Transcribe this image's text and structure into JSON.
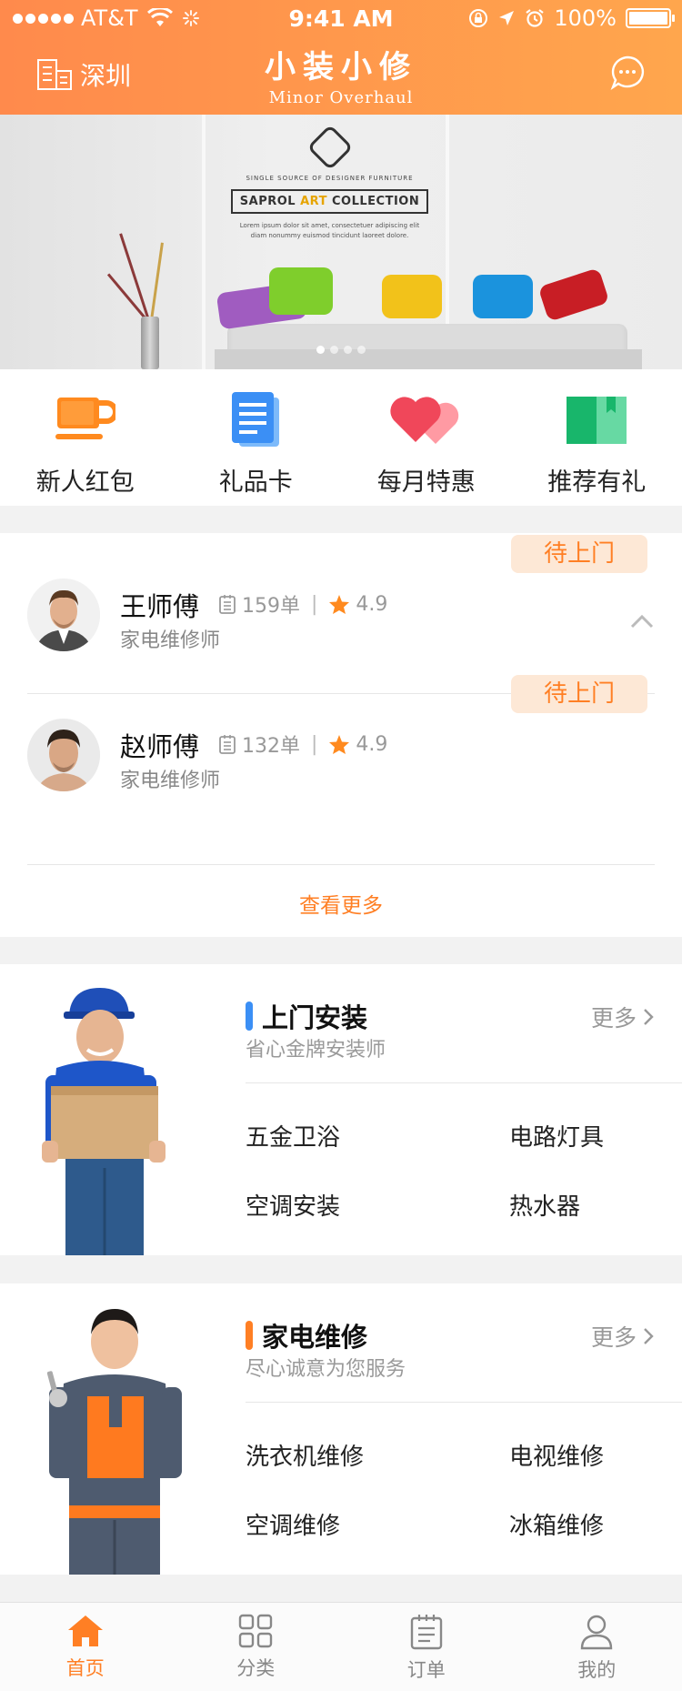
{
  "status_bar": {
    "carrier": "AT&T",
    "time": "9:41 AM",
    "battery": "100%"
  },
  "header": {
    "city": "深圳",
    "logo_cn": "小装小修",
    "logo_en": "Minor Overhaul",
    "chat_icon": "chat-bubble-icon"
  },
  "banner": {
    "brand_tagline": "SINGLE SOURCE OF DESIGNER FURNITURE",
    "brand_prefix": "SAPROL ",
    "brand_art": "ART",
    "brand_suffix": " COLLECTION",
    "brand_lorem": "Lorem ipsum dolor sit amet, consectetuer adipiscing elit diam nonummy euismod tincidunt laoreet dolore.",
    "slide_count": 4,
    "active_slide": 1
  },
  "quick_menu": [
    {
      "label": "新人红包",
      "icon": "cup-icon",
      "color": "#ff8a1f"
    },
    {
      "label": "礼品卡",
      "icon": "document-icon",
      "color": "#3b8ff5"
    },
    {
      "label": "每月特惠",
      "icon": "heart-icon",
      "color": "#f0475a"
    },
    {
      "label": "推荐有礼",
      "icon": "book-icon",
      "color": "#22c47a"
    }
  ],
  "technicians": [
    {
      "name": "王师傅",
      "orders": "159单",
      "rating": "4.9",
      "role": "家电维修师",
      "status": "待上门"
    },
    {
      "name": "赵师傅",
      "orders": "132单",
      "rating": "4.9",
      "role": "家电维修师",
      "status": "待上门"
    }
  ],
  "technicians_more": "查看更多",
  "services": [
    {
      "title": "上门安装",
      "subtitle": "省心金牌安装师",
      "more": "更多",
      "accent": "#3b8ff5",
      "items": [
        "五金卫浴",
        "电路灯具",
        "空调安装",
        "热水器"
      ]
    },
    {
      "title": "家电维修",
      "subtitle": "尽心诚意为您服务",
      "more": "更多",
      "accent": "#ff7f24",
      "items": [
        "洗衣机维修",
        "电视维修",
        "空调维修",
        "冰箱维修"
      ]
    }
  ],
  "tab_bar": [
    {
      "label": "首页",
      "icon": "home-icon",
      "active": true
    },
    {
      "label": "分类",
      "icon": "grid-icon",
      "active": false
    },
    {
      "label": "订单",
      "icon": "order-list-icon",
      "active": false
    },
    {
      "label": "我的",
      "icon": "user-icon",
      "active": false
    }
  ],
  "colors": {
    "primary": "#ff7f24",
    "header_gradient_start": "#ff8a4c",
    "header_gradient_end": "#ffa64d",
    "badge_bg": "#fde8d6",
    "star": "#ff8a1f"
  }
}
